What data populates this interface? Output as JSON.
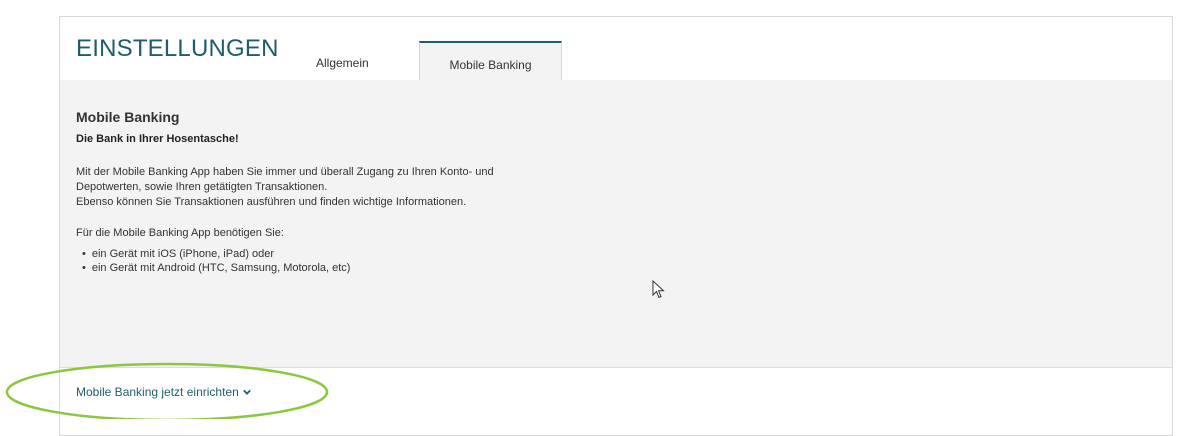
{
  "header": {
    "title": "EINSTELLUNGEN",
    "tabs": [
      {
        "label": "Allgemein",
        "active": false
      },
      {
        "label": "Mobile Banking",
        "active": true
      }
    ]
  },
  "content": {
    "heading": "Mobile Banking",
    "subheading": "Die Bank in Ihrer Hosentasche!",
    "paragraph_lines": [
      "Mit der Mobile Banking App haben Sie immer und überall Zugang zu Ihren Konto- und",
      "Depotwerten, sowie Ihren getätigten Transaktionen.",
      "Ebenso können Sie Transaktionen ausführen und finden wichtige Informationen."
    ],
    "requirements_intro": "Für die Mobile Banking App benötigen Sie:",
    "requirements": [
      "ein Gerät mit iOS (iPhone, iPad) oder",
      "ein Gerät mit Android (HTC, Samsung, Motorola, etc)"
    ]
  },
  "footer": {
    "setup_link": "Mobile Banking jetzt einrichten"
  },
  "icons": {
    "cursor": "mouse-pointer-icon",
    "chevron": "chevron-down-icon"
  },
  "colors": {
    "accent": "#1f5d6b",
    "content_bg": "#f3f3f3",
    "annotation": "#8dc63f"
  }
}
